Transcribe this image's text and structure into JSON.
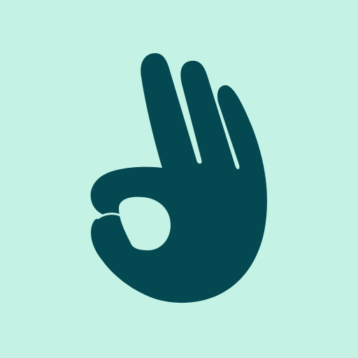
{
  "icon": {
    "name": "ok-hand-gesture-icon",
    "background_color": "#c4f3e6",
    "foreground_color": "#044951"
  }
}
